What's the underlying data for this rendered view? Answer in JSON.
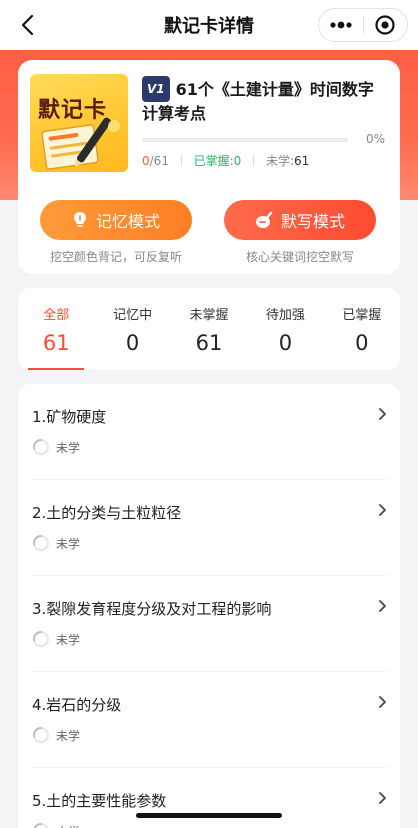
{
  "nav": {
    "title": "默记卡详情"
  },
  "card": {
    "cover_text": "默记卡",
    "version": "V1",
    "title": "61个《土建计量》时间数字计算考点",
    "progress_pct": 0,
    "progress_label": "0%",
    "done": "0",
    "total": "/61",
    "mastered_label": "已掌握:",
    "mastered_value": "0",
    "unlearned_label": "未学:",
    "unlearned_value": "61"
  },
  "modes": {
    "memory_label": "记忆模式",
    "memory_desc": "挖空颜色背记，可反复听",
    "dictation_label": "默写模式",
    "dictation_desc": "核心关键词挖空默写"
  },
  "tabs": [
    {
      "label": "全部",
      "count": "61"
    },
    {
      "label": "记忆中",
      "count": "0"
    },
    {
      "label": "未掌握",
      "count": "61"
    },
    {
      "label": "待加强",
      "count": "0"
    },
    {
      "label": "已掌握",
      "count": "0"
    }
  ],
  "items": [
    {
      "title": "1.矿物硬度",
      "status": "未学"
    },
    {
      "title": "2.土的分类与土粒粒径",
      "status": "未学"
    },
    {
      "title": "3.裂隙发育程度分级及对工程的影响",
      "status": "未学"
    },
    {
      "title": "4.岩石的分级",
      "status": "未学"
    },
    {
      "title": "5.土的主要性能参数",
      "status": "未学"
    }
  ],
  "colors": {
    "accent": "#ff4b32",
    "memory": "#ff8a2c",
    "mastered": "#2cb36a"
  },
  "icons": {
    "back": "chevron-left-icon",
    "more": "more-dots-icon",
    "target": "target-icon",
    "memory": "lightbulb-icon",
    "dictation": "pen-icon",
    "chevron": "chevron-right-icon",
    "status": "loading-circle-icon"
  }
}
